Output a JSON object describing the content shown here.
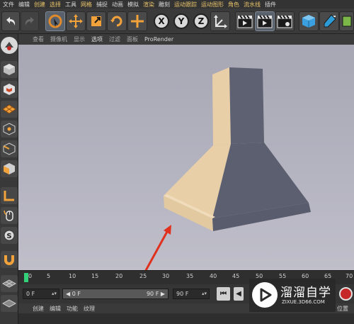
{
  "menu": [
    "文件",
    "编辑",
    "创建",
    "选择",
    "工具",
    "网格",
    "捕捉",
    "动画",
    "模拟",
    "渲染",
    "雕刻",
    "运动跟踪",
    "运动图形",
    "角色",
    "流水线",
    "插件"
  ],
  "axis_buttons": [
    "X",
    "Y",
    "Z"
  ],
  "viewport_menu": [
    "查看",
    "摄像机",
    "显示",
    "选项",
    "过滤",
    "面板",
    "ProRender"
  ],
  "timeline": {
    "ticks": [
      "0",
      "5",
      "10",
      "15",
      "20",
      "25",
      "30",
      "35",
      "40",
      "45",
      "50",
      "55",
      "60",
      "65",
      "70"
    ],
    "current_frame": "0 F",
    "range_start": "◀ 0 F",
    "range_end": "90 F ▶",
    "end_frame": "90 F"
  },
  "bottom_menu": [
    "创建",
    "编辑",
    "功能",
    "纹理"
  ],
  "right_label": "位置",
  "watermark": {
    "title": "溜溜自学",
    "url": "ZIXUE.3D66.COM"
  },
  "colors": {
    "viewport_top": "#a7a6b3",
    "playhead": "#33d17a",
    "annotation_arrow": "#e0301e"
  }
}
